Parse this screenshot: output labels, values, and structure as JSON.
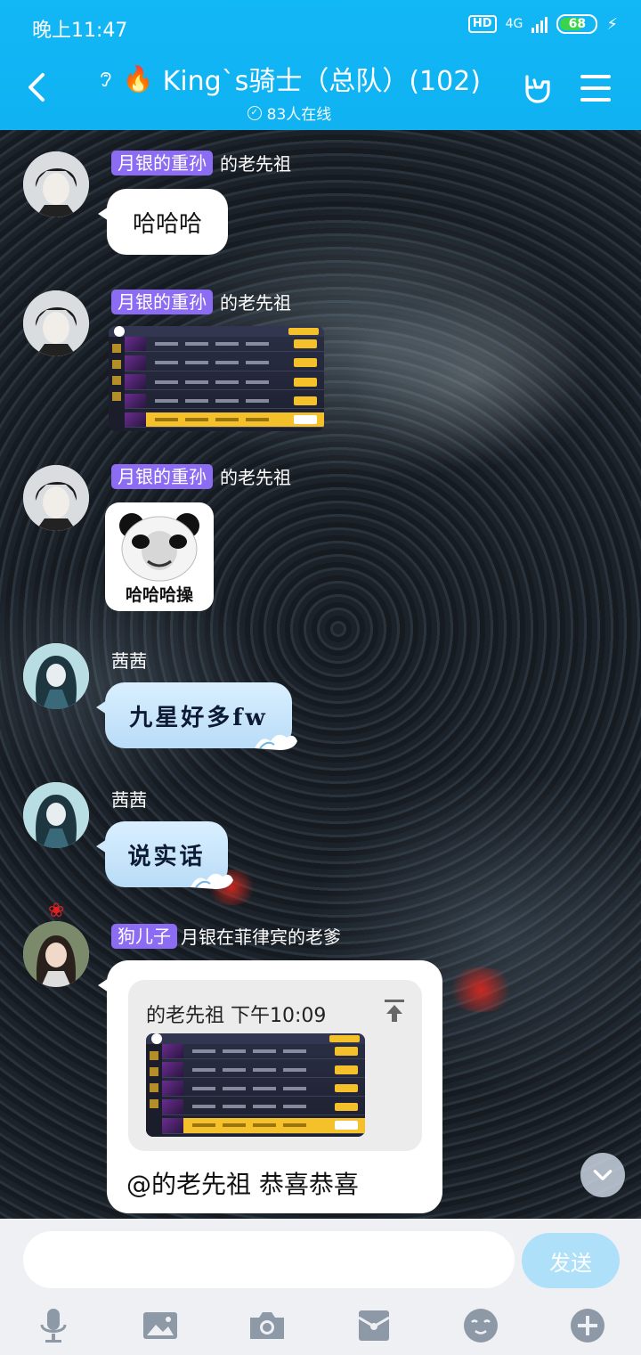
{
  "status_bar": {
    "time": "晚上11:47",
    "hd": "HD",
    "network": "4G",
    "battery": "68",
    "battery_level_percent": 68
  },
  "header": {
    "title": "King`s骑士（总队）(102)",
    "online": "83人在线"
  },
  "messages": [
    {
      "badge": "月银的重孙",
      "sender": "的老先祖",
      "type": "text",
      "text": "哈哈哈"
    },
    {
      "badge": "月银的重孙",
      "sender": "的老先祖",
      "type": "image"
    },
    {
      "badge": "月银的重孙",
      "sender": "的老先祖",
      "type": "sticker",
      "caption": "哈哈哈操"
    },
    {
      "sender": "茜茜",
      "type": "text",
      "text": "九星好多fw"
    },
    {
      "sender": "茜茜",
      "type": "text",
      "text": "说实话"
    },
    {
      "badge": "狗儿子",
      "sender": "月银在菲律宾的老爹",
      "type": "reply",
      "quote_header": "的老先祖 下午10:09",
      "text": "@的老先祖 恭喜恭喜"
    }
  ],
  "composer": {
    "placeholder": "",
    "send_label": "发送"
  },
  "toolbar_icons": [
    "mic-icon",
    "image-icon",
    "camera-icon",
    "red-packet-icon",
    "emoji-icon",
    "plus-icon"
  ],
  "colors": {
    "header": "#12b7f5",
    "badge": "#8b6cf2",
    "send_button": "#aee0fa"
  }
}
